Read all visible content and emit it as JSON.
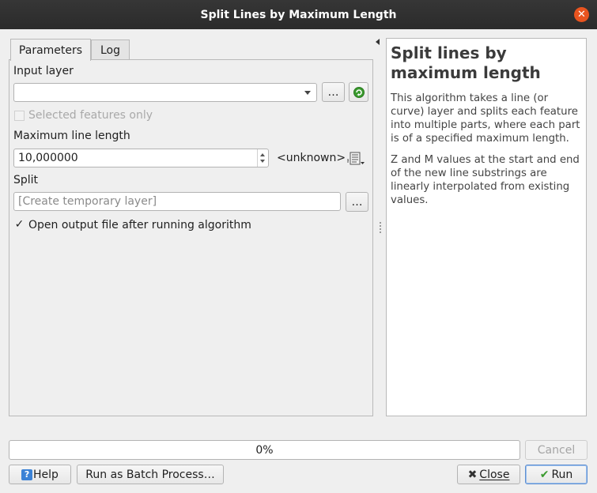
{
  "window": {
    "title": "Split Lines by Maximum Length"
  },
  "tabs": [
    {
      "label": "Parameters"
    },
    {
      "label": "Log"
    }
  ],
  "params": {
    "input_layer_label": "Input layer",
    "input_layer_value": "",
    "input_browse_label": "…",
    "selected_only_label": "Selected features only",
    "max_length_label": "Maximum line length",
    "max_length_value": "10,000000",
    "unit_label": "<unknown>",
    "split_label": "Split",
    "split_placeholder": "[Create temporary layer]",
    "split_browse_label": "…",
    "open_output_label": "Open output file after running algorithm",
    "open_output_checked": true
  },
  "help": {
    "title": "Split lines by maximum length",
    "paragraphs": [
      "This algorithm takes a line (or curve) layer and splits each feature into multiple parts, where each part is of a specified maximum length.",
      "Z and M values at the start and end of the new line substrings are linearly interpolated from existing values."
    ]
  },
  "progress": {
    "text": "0%",
    "value": 0
  },
  "buttons": {
    "cancel": "Cancel",
    "help": "Help",
    "batch": "Run as Batch Process…",
    "close": "Close",
    "run": "Run"
  },
  "icons": {
    "close": "close-icon",
    "iterate": "iterate-icon",
    "data_defined": "data-defined-icon",
    "help": "help-icon",
    "close_btn": "close-x-icon",
    "run": "checkmark-icon"
  },
  "colors": {
    "titlebar": "#2e2e2e",
    "close_button": "#e9541f",
    "accent_green": "#3a9a2e",
    "help_blue": "#3b82d6"
  }
}
